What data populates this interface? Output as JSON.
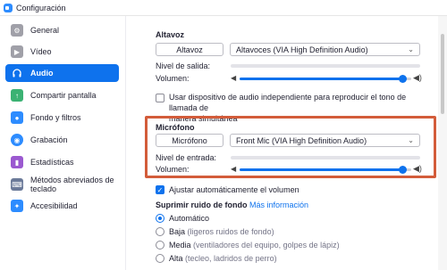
{
  "window": {
    "title": "Configuración"
  },
  "sidebar": {
    "items": [
      {
        "label": "General",
        "icon": "gear-icon",
        "color": "#a0a0a8"
      },
      {
        "label": "Vídeo",
        "icon": "video-camera-icon",
        "color": "#a0a0a8"
      },
      {
        "label": "Audio",
        "icon": "headphones-icon",
        "color": "#0e72ed"
      },
      {
        "label": "Compartir pantalla",
        "icon": "share-screen-icon",
        "color": "#3bb273"
      },
      {
        "label": "Fondo y filtros",
        "icon": "background-icon",
        "color": "#2d8cff"
      },
      {
        "label": "Grabación",
        "icon": "record-icon",
        "color": "#2d8cff"
      },
      {
        "label": "Estadísticas",
        "icon": "statistics-icon",
        "color": "#9b59d0"
      },
      {
        "label": "Métodos abreviados de teclado",
        "icon": "keyboard-icon",
        "color": "#6b7a99"
      },
      {
        "label": "Accesibilidad",
        "icon": "accessibility-icon",
        "color": "#2d8cff"
      }
    ],
    "active_index": 2
  },
  "speaker": {
    "title": "Altavoz",
    "test_button": "Altavoz",
    "device": "Altavoces (VIA High Definition Audio)",
    "output_level_label": "Nivel de salida:",
    "volume_label": "Volumen:",
    "volume": 0.97
  },
  "separate_device": {
    "checked": false,
    "label_line1": "Usar dispositivo de audio independiente para reproducir el tono de llamada de",
    "label_line2": "manera simultánea"
  },
  "microphone": {
    "title": "Micrófono",
    "test_button": "Micrófono",
    "device": "Front Mic (VIA High Definition Audio)",
    "input_level_label": "Nivel de entrada:",
    "volume_label": "Volumen:",
    "volume": 0.97
  },
  "auto_adjust": {
    "checked": true,
    "label": "Ajustar automáticamente el volumen"
  },
  "noise": {
    "title": "Suprimir ruido de fondo",
    "more_info": "Más información",
    "options": [
      {
        "label": "Automático",
        "hint": "",
        "checked": true
      },
      {
        "label": "Baja",
        "hint": "(ligeros ruidos de fondo)",
        "checked": false
      },
      {
        "label": "Media",
        "hint": "(ventiladores del equipo, golpes de lápiz)",
        "checked": false
      },
      {
        "label": "Alta",
        "hint": "(tecleo, ladridos de perro)",
        "checked": false
      }
    ]
  },
  "colors": {
    "accent": "#0e72ed",
    "highlight": "#d35c3a"
  }
}
